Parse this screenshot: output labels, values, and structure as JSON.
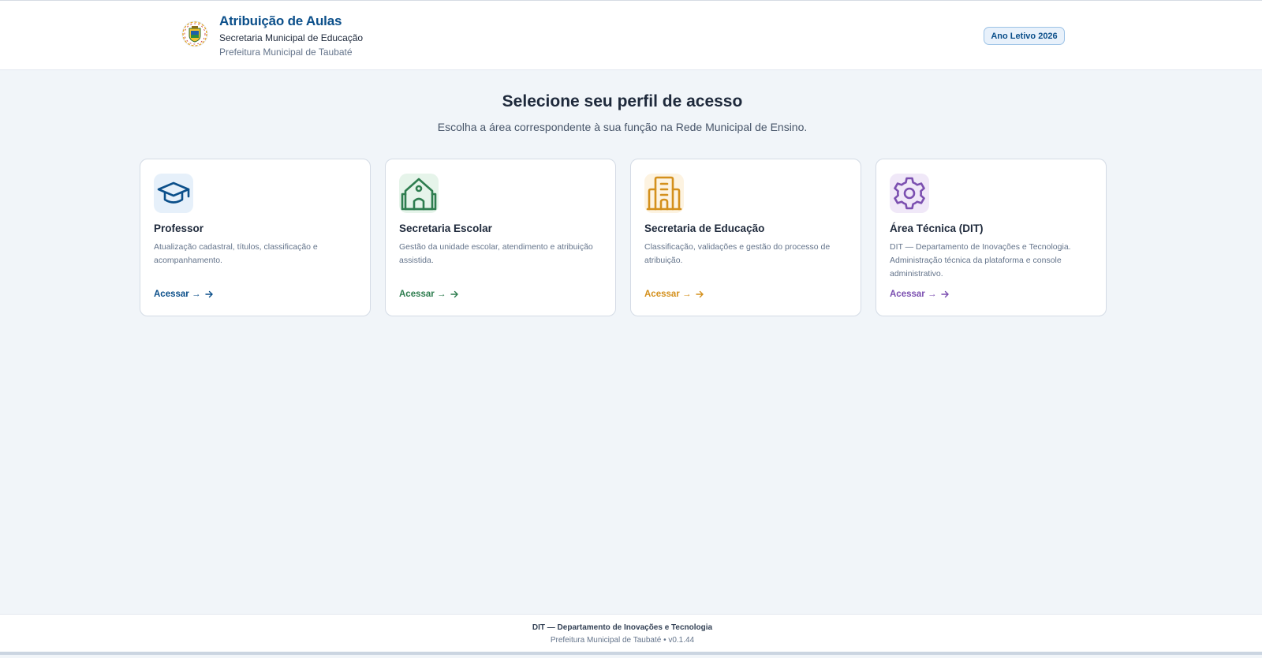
{
  "header": {
    "title": "Atribuição de Aulas",
    "subtitle": "Secretaria Municipal de Educação",
    "subtitle2": "Prefeitura Municipal de Taubaté",
    "year_badge": "Ano Letivo 2026"
  },
  "main": {
    "title": "Selecione seu perfil de acesso",
    "subtitle": "Escolha a área correspondente à sua função na Rede Municipal de Ensino."
  },
  "cards": [
    {
      "icon": "graduation-cap-icon",
      "title": "Professor",
      "description": "Atualização cadastral, títulos, classificação e acompanhamento.",
      "link": "Acessar →",
      "color": "#0b4f8a",
      "bg": "#e6f0fa"
    },
    {
      "icon": "school-icon",
      "title": "Secretaria Escolar",
      "description": "Gestão da unidade escolar, atendimento e atribuição assistida.",
      "link": "Acessar →",
      "color": "#2e7d4f",
      "bg": "#e6f4ea"
    },
    {
      "icon": "building-icon",
      "title": "Secretaria de Educação",
      "description": "Classificação, validações e gestão do processo de atribuição.",
      "link": "Acessar →",
      "color": "#d4901c",
      "bg": "#fdf3e1"
    },
    {
      "icon": "gear-icon",
      "title": "Área Técnica (DIT)",
      "description": "DIT — Departamento de Inovações e Tecnologia. Administração técnica da plataforma e console administrativo.",
      "link": "Acessar →",
      "color": "#7b4fb0",
      "bg": "#f0e8f8"
    }
  ],
  "footer": {
    "line1": "DIT — Departamento de Inovações e Tecnologia",
    "line2": "Prefeitura Municipal de Taubaté • v0.1.44"
  }
}
